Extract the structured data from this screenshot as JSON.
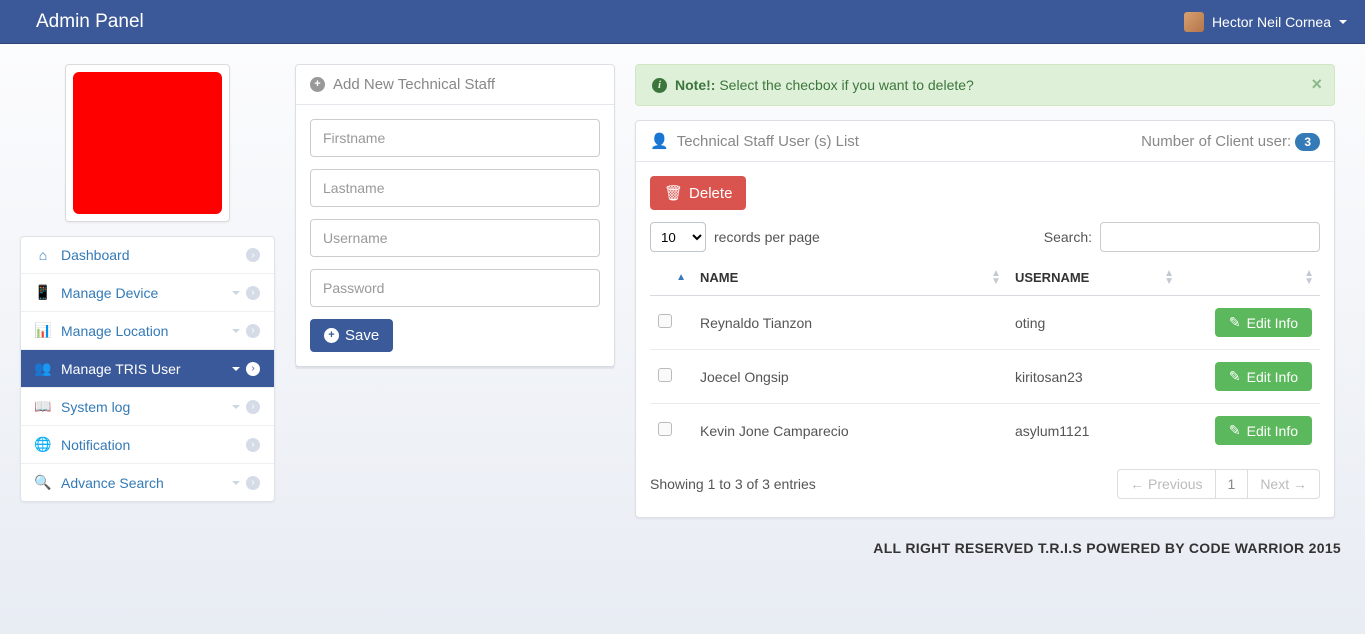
{
  "topbar": {
    "title": "Admin Panel",
    "username": "Hector Neil Cornea"
  },
  "sidebar": {
    "items": [
      {
        "label": "Dashboard",
        "iconGlyph": "⌂",
        "hasCaret": false
      },
      {
        "label": "Manage Device",
        "iconGlyph": "📱",
        "hasCaret": true
      },
      {
        "label": "Manage Location",
        "iconGlyph": "📊",
        "hasCaret": true
      },
      {
        "label": "Manage TRIS User",
        "iconGlyph": "👥",
        "hasCaret": true
      },
      {
        "label": "System log",
        "iconGlyph": "📖",
        "hasCaret": true
      },
      {
        "label": "Notification",
        "iconGlyph": "🌐",
        "hasCaret": false
      },
      {
        "label": "Advance Search",
        "iconGlyph": "🔍",
        "hasCaret": true
      }
    ]
  },
  "form": {
    "heading": "Add New Technical Staff",
    "ph_first": "Firstname",
    "ph_last": "Lastname",
    "ph_user": "Username",
    "ph_pass": "Password",
    "saveLabel": "Save"
  },
  "alert": {
    "prefix": "Note!:",
    "message": "Select the checbox if you want to delete?"
  },
  "listPanel": {
    "heading": "Technical Staff User (s) List",
    "countLabel": "Number of Client user:",
    "countValue": "3",
    "deleteLabel": "Delete",
    "recordsPerPageValue": "10",
    "recordsPerPageSuffix": "records per page",
    "searchLabel": "Search:",
    "columns": {
      "name": "NAME",
      "username": "USERNAME"
    },
    "editLabel": "Edit Info",
    "rows": [
      {
        "name": "Reynaldo Tianzon",
        "username": "oting"
      },
      {
        "name": "Joecel Ongsip",
        "username": "kiritosan23"
      },
      {
        "name": "Kevin Jone Camparecio",
        "username": "asylum1121"
      }
    ],
    "showing": "Showing 1 to 3 of 3 entries",
    "prevLabel": "Previous",
    "pageLabel": "1",
    "nextLabel": "Next"
  },
  "footer": "ALL RIGHT RESERVED T.R.I.S POWERED BY CODE WARRIOR 2015"
}
